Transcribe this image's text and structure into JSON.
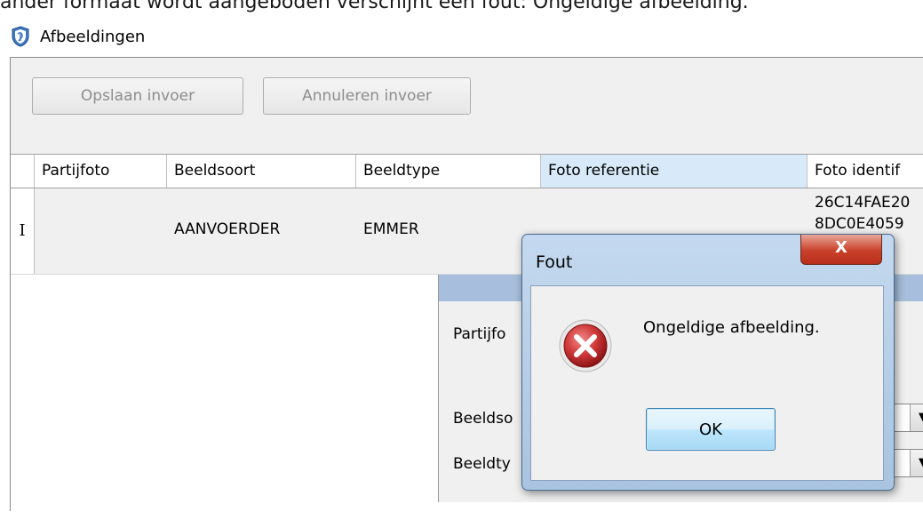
{
  "document": {
    "text": "ander formaat wordt aangeboden verschijnt een fout: Ongeldige afbeelding."
  },
  "window": {
    "title": "Afbeeldingen",
    "icon": "shield-app-icon"
  },
  "toolbar": {
    "save_label": "Opslaan invoer",
    "cancel_label": "Annuleren invoer"
  },
  "grid": {
    "columns": [
      "Partijfoto",
      "Beeldsoort",
      "Beeldtype",
      "Foto referentie",
      "Foto identif"
    ],
    "selected_column": "Foto referentie",
    "row": {
      "row_marker": "I",
      "partijfoto": "",
      "beeldsoort": "AANVOERDER",
      "beeldtype": "EMMER",
      "foto_referentie": "",
      "foto_id_line1": "26C14FAE20",
      "foto_id_line2": "8DC0E4059"
    }
  },
  "form": {
    "labels": [
      "Partijfo",
      "Beeldso",
      "Beeldty"
    ]
  },
  "dialog": {
    "title": "Fout",
    "close_symbol": "X",
    "message": "Ongeldige afbeelding.",
    "ok_label": "OK",
    "icon": "error-icon"
  },
  "colors": {
    "selected_header": "#d8eaf9",
    "form_title_bar": "#a7bfdc",
    "error_red": "#d03a3a"
  }
}
